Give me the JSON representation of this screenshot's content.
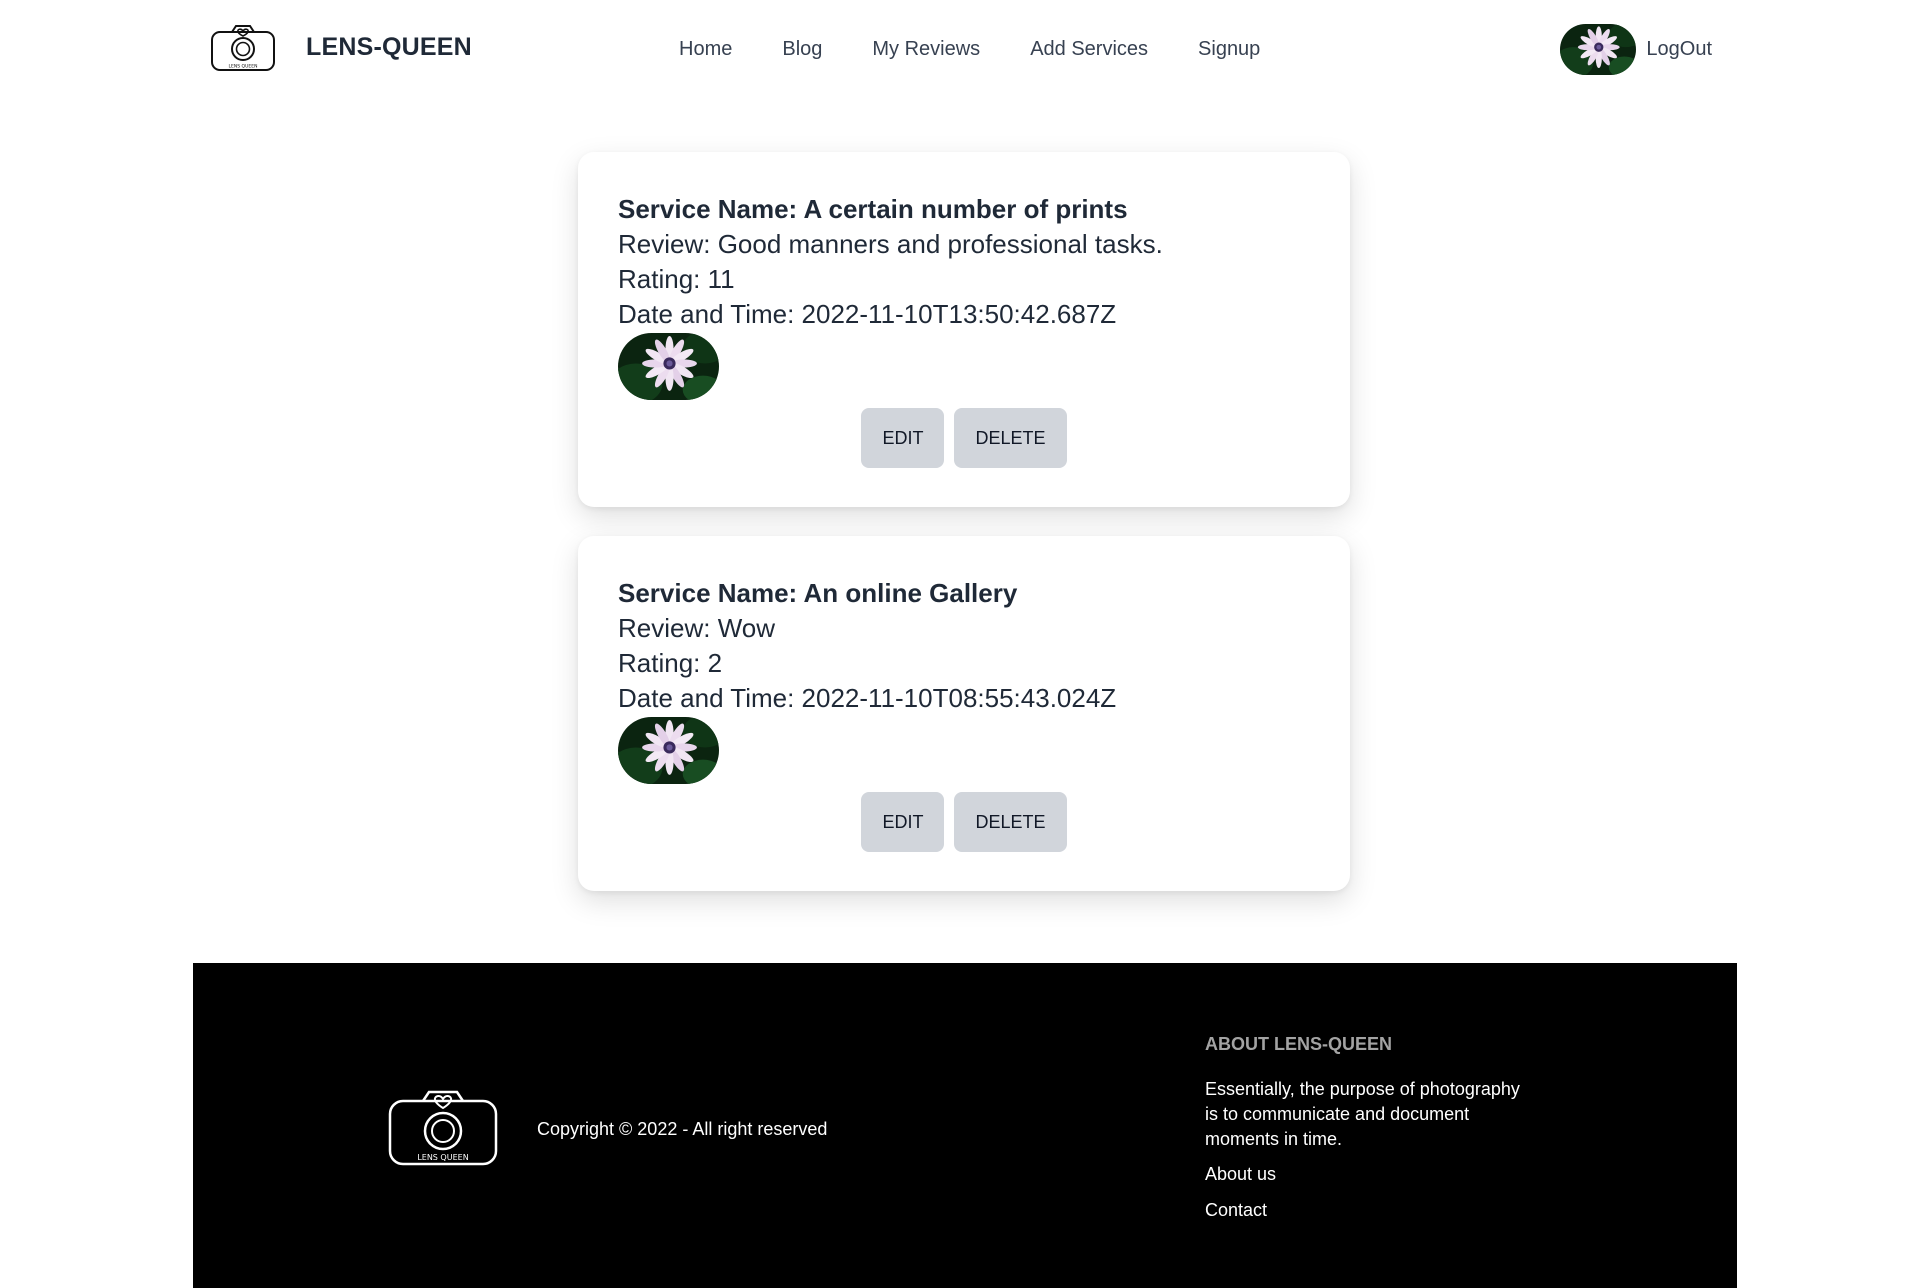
{
  "brand": {
    "name": "LENS-QUEEN",
    "logo_icon": "camera-heart-icon",
    "logo_text": "LENS QUEEN"
  },
  "nav": {
    "items": [
      {
        "label": "Home"
      },
      {
        "label": "Blog"
      },
      {
        "label": "My Reviews"
      },
      {
        "label": "Add Services"
      },
      {
        "label": "Signup"
      }
    ],
    "logout_label": "LogOut",
    "avatar_icon": "flower-avatar-icon"
  },
  "reviews": [
    {
      "service": "Service Name: A certain number of prints",
      "review": "Review: Good manners and professional tasks.",
      "rating": "Rating: 11",
      "datetime": "Date and Time: 2022-11-10T13:50:42.687Z",
      "edit_label": "EDIT",
      "delete_label": "DELETE"
    },
    {
      "service": "Service Name: An online Gallery",
      "review": "Review: Wow",
      "rating": "Rating: 2",
      "datetime": "Date and Time: 2022-11-10T08:55:43.024Z",
      "edit_label": "EDIT",
      "delete_label": "DELETE"
    }
  ],
  "footer": {
    "copyright": "Copyright © 2022 - All right reserved",
    "about_heading": "ABOUT LENS-QUEEN",
    "about_text": "Essentially, the purpose of photography is to communicate and document moments in time.",
    "links": [
      {
        "label": "About us"
      },
      {
        "label": "Contact"
      }
    ],
    "logo_text": "LENS QUEEN"
  },
  "colors": {
    "button_bg": "#d1d5db",
    "footer_bg": "#000000",
    "footer_heading": "#a3a3a3",
    "text": "#1f2937"
  }
}
